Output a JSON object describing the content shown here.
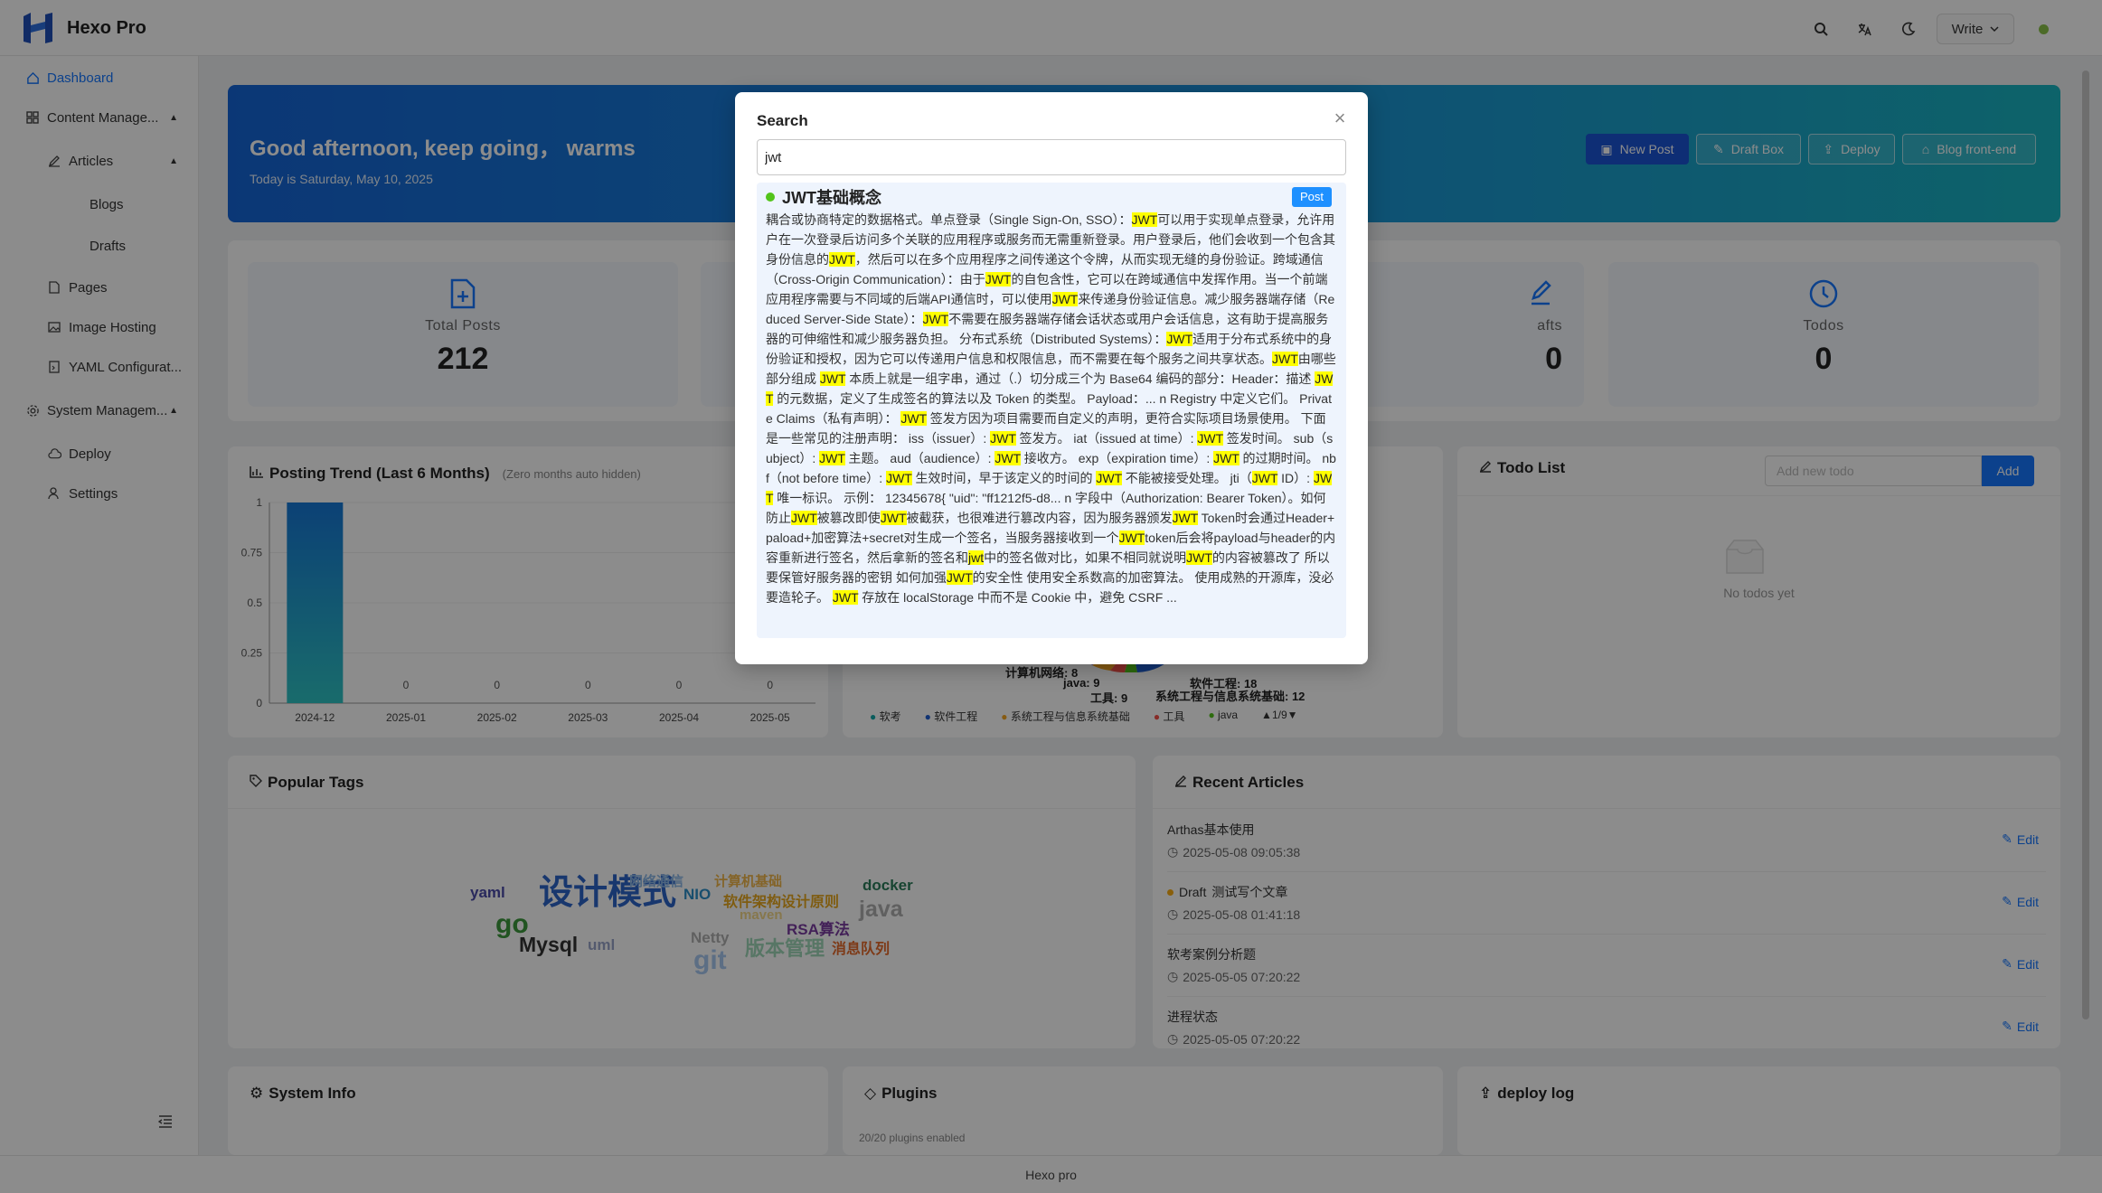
{
  "app": {
    "title": "Hexo Pro"
  },
  "header": {
    "write_label": "Write"
  },
  "sidebar": {
    "items": [
      {
        "label": "Dashboard"
      },
      {
        "label": "Content Manage..."
      },
      {
        "label": "Articles"
      },
      {
        "label": "Blogs"
      },
      {
        "label": "Drafts"
      },
      {
        "label": "Pages"
      },
      {
        "label": "Image Hosting"
      },
      {
        "label": "YAML Configurat..."
      },
      {
        "label": "System Managem..."
      },
      {
        "label": "Deploy"
      },
      {
        "label": "Settings"
      }
    ]
  },
  "hero": {
    "greeting": "Good afternoon, keep going，  warms",
    "date": "Today is Saturday, May 10, 2025",
    "buttons": {
      "new_post": "New Post",
      "draft_box": "Draft Box",
      "deploy": "Deploy",
      "blog_front": "Blog front-end"
    }
  },
  "stats": [
    {
      "label": "Total Posts",
      "value": "212"
    },
    {
      "label": "afts",
      "value": "0"
    },
    {
      "label": "Todos",
      "value": "0"
    }
  ],
  "posting_trend": {
    "title": "Posting Trend (Last 6 Months)",
    "hint": "(Zero months auto hidden)"
  },
  "chart_data": {
    "type": "bar",
    "categories": [
      "2024-12",
      "2025-01",
      "2025-02",
      "2025-03",
      "2025-04",
      "2025-05"
    ],
    "values": [
      1,
      0,
      0,
      0,
      0,
      0
    ],
    "value_labels": [
      "",
      "0",
      "0",
      "0",
      "0",
      "0"
    ],
    "ylim": [
      0,
      1
    ],
    "yticks": [
      "0",
      "0.25",
      "0.5",
      "0.75",
      "1"
    ],
    "color": "#1677d6",
    "title": "",
    "xlabel": "",
    "ylabel": ""
  },
  "category_chart": {
    "slice_labels": [
      "计算机网络: 8",
      "java: 9",
      "工具: 9",
      "软件工程: 18",
      "系统工程与信息系统基础: 12"
    ],
    "legend": [
      {
        "name": "软考",
        "color": "#13a8a8"
      },
      {
        "name": "软件工程",
        "color": "#1f5fd1"
      },
      {
        "name": "系统工程与信息系统基础",
        "color": "#f5a623"
      },
      {
        "name": "工具",
        "color": "#f5504a"
      },
      {
        "name": "java",
        "color": "#52c41a"
      }
    ],
    "pager": "1/9"
  },
  "todo": {
    "title": "Todo List",
    "placeholder": "Add new todo",
    "add_label": "Add",
    "empty": "No todos yet"
  },
  "tags": {
    "title": "Popular Tags",
    "items": [
      {
        "text": "设计模式",
        "color": "#2d64c8"
      },
      {
        "text": "yaml",
        "color": "#4a4aa8"
      },
      {
        "text": "go",
        "color": "#3c9a3c"
      },
      {
        "text": "Mysql",
        "color": "#333333"
      },
      {
        "text": "uml",
        "color": "#9aa4c8"
      },
      {
        "text": "网络通信",
        "color": "#8cb8e8"
      },
      {
        "text": "NIO",
        "color": "#2d8fc8"
      },
      {
        "text": "计算机基础",
        "color": "#f0b64a"
      },
      {
        "text": "软件架构设计原则",
        "color": "#e8a81e"
      },
      {
        "text": "maven",
        "color": "#f5d98a"
      },
      {
        "text": "docker",
        "color": "#2b7d5a"
      },
      {
        "text": "java",
        "color": "#b0b0b0"
      },
      {
        "text": "RSA算法",
        "color": "#7a3ca0"
      },
      {
        "text": "Netty",
        "color": "#b0b0b0"
      },
      {
        "text": "git",
        "color": "#a8c8f0"
      },
      {
        "text": "版本管理",
        "color": "#9fd8b8"
      },
      {
        "text": "消息队列",
        "color": "#e56a2a"
      }
    ]
  },
  "recent": {
    "title": "Recent Articles",
    "edit_label": "Edit",
    "draft_label": "Draft",
    "items": [
      {
        "title": "Arthas基本使用",
        "date": "2025-05-08 09:05:38",
        "draft": false
      },
      {
        "title": "测试写个文章",
        "date": "2025-05-08 01:41:18",
        "draft": true
      },
      {
        "title": "软考案例分析题",
        "date": "2025-05-05 07:20:22",
        "draft": false
      },
      {
        "title": "进程状态",
        "date": "2025-05-05 07:20:22",
        "draft": false
      }
    ]
  },
  "bottom": {
    "system_info": "System Info",
    "plugins": "Plugins",
    "plugins_sub": "20/20 plugins enabled",
    "deploy_log": "deploy log"
  },
  "footer": {
    "text": "Hexo pro"
  },
  "search_modal": {
    "title": "Search",
    "query": "jwt",
    "result_title": "JWT基础概念",
    "result_tag": "Post",
    "result_segments": [
      "耦合或协商特定的数据格式。单点登录（Single Sign-On, SSO）：",
      "JWT",
      "可以用于实现单点登录，允许用户在一次登录后访问多个关联的应用程序或服务而无需重新登录。用户登录后，他们会收到一个包含其身份信息的",
      "JWT",
      "，然后可以在多个应用程序之间传递这个令牌，从而实现无缝的身份验证。跨域通信（Cross-Origin Communication）：由于",
      "JWT",
      "的自包含性，它可以在跨域通信中发挥作用。当一个前端应用程序需要与不同域的后端API通信时，可以使用",
      "JWT",
      "来传递身份验证信息。减少服务器端存储（Reduced Server-Side State）：",
      "JWT",
      "不需要在服务器端存储会话状态或用户会话信息，这有助于提高服务器的可伸缩性和减少服务器负担。 分布式系统（Distributed Systems）：",
      "JWT",
      "适用于分布式系统中的身份验证和授权，因为它可以传递用户信息和权限信息，而不需要在每个服务之间共享状态。",
      "JWT",
      "由哪些部分组成 ",
      "JWT",
      " 本质上就是一组字串，通过（.）切分成三个为 Base64 编码的部分：Header：描述 ",
      "JWT",
      " 的元数据，定义了生成签名的算法以及 Token 的类型。 Payload：... n Registry 中定义它们。 Private Claims（私有声明）： ",
      "JWT",
      " 签发方因为项目需要而自定义的声明，更符合实际项目场景使用。 下面是一些常见的注册声明： iss（issuer）: ",
      "JWT",
      " 签发方。 iat（issued at time）: ",
      "JWT",
      " 签发时间。 sub（subject）: ",
      "JWT",
      " 主题。 aud（audience）: ",
      "JWT",
      " 接收方。 exp（expiration time）: ",
      "JWT",
      " 的过期时间。 nbf（not before time）: ",
      "JWT",
      " 生效时间，早于该定义的时间的 ",
      "JWT",
      " 不能被接受处理。 jti（",
      "JWT",
      " ID）: ",
      "JWT",
      " 唯一标识。 示例： 12345678{ \"uid\": \"ff1212f5-d8... n 字段中（Authorization: Bearer Token）。如何防止",
      "JWT",
      "被篡改即使",
      "JWT",
      "被截获，也很难进行篡改内容，因为服务器颁发",
      "JWT",
      " Token时会通过Header+paload+加密算法+secret对生成一个签名，当服务器接收到一个",
      "JWT",
      "token后会将payload与header的内容重新进行签名，然后拿新的签名和",
      "jwt",
      "中的签名做对比，如果不相同就说明",
      "JWT",
      "的内容被篡改了 所以要保管好服务器的密钥 如何加强",
      "JWT",
      "的安全性 使用安全系数高的加密算法。 使用成熟的开源库，没必要造轮子。 ",
      "JWT",
      " 存放在 localStorage 中而不是 Cookie 中，避免 CSRF ..."
    ]
  }
}
